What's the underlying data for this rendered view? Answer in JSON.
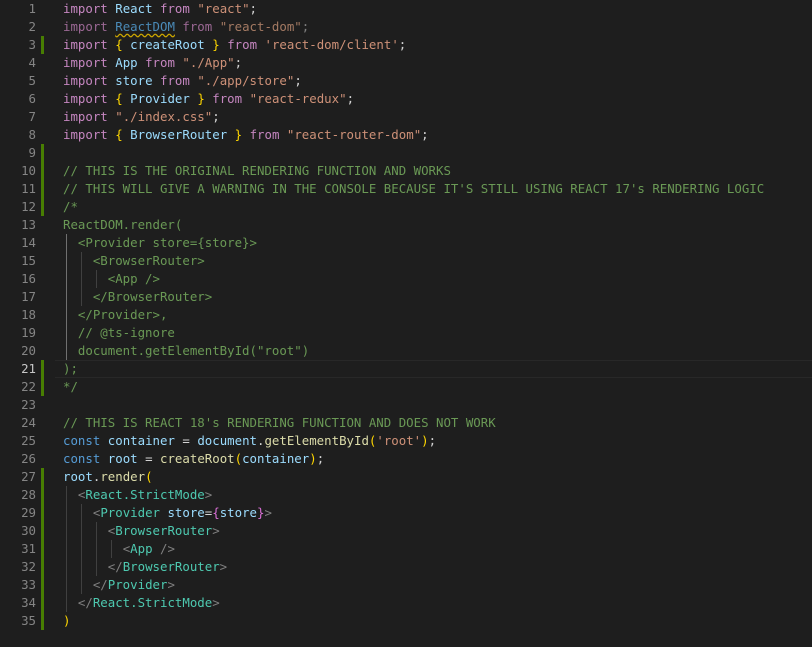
{
  "editor": {
    "language": "javascript",
    "active_line": "21",
    "lines": [
      {
        "n": "1",
        "tokens": [
          [
            "kw",
            "import"
          ],
          [
            "pl",
            " "
          ],
          [
            "id",
            "React"
          ],
          [
            "pl",
            " "
          ],
          [
            "kw",
            "from"
          ],
          [
            "pl",
            " "
          ],
          [
            "str",
            "\"react\""
          ],
          [
            "pl",
            ";"
          ]
        ]
      },
      {
        "n": "2",
        "tokens": [
          [
            "kwd",
            "import"
          ],
          [
            "pl",
            " "
          ],
          [
            "idd squiggle",
            "ReactDOM"
          ],
          [
            "pl",
            " "
          ],
          [
            "kwd",
            "from"
          ],
          [
            "pl",
            " "
          ],
          [
            "strd",
            "\"react-dom\""
          ],
          [
            "tgd",
            ";"
          ]
        ]
      },
      {
        "n": "3",
        "tokens": [
          [
            "kw",
            "import"
          ],
          [
            "pl",
            " "
          ],
          [
            "br1",
            "{"
          ],
          [
            "pl",
            " "
          ],
          [
            "id",
            "createRoot"
          ],
          [
            "pl",
            " "
          ],
          [
            "br1",
            "}"
          ],
          [
            "pl",
            " "
          ],
          [
            "kw",
            "from"
          ],
          [
            "pl",
            " "
          ],
          [
            "str",
            "'react-dom/client'"
          ],
          [
            "pl",
            ";"
          ]
        ]
      },
      {
        "n": "4",
        "tokens": [
          [
            "kw",
            "import"
          ],
          [
            "pl",
            " "
          ],
          [
            "id",
            "App"
          ],
          [
            "pl",
            " "
          ],
          [
            "kw",
            "from"
          ],
          [
            "pl",
            " "
          ],
          [
            "str",
            "\"./App\""
          ],
          [
            "pl",
            ";"
          ]
        ]
      },
      {
        "n": "5",
        "tokens": [
          [
            "kw",
            "import"
          ],
          [
            "pl",
            " "
          ],
          [
            "id",
            "store"
          ],
          [
            "pl",
            " "
          ],
          [
            "kw",
            "from"
          ],
          [
            "pl",
            " "
          ],
          [
            "str",
            "\"./app/store\""
          ],
          [
            "pl",
            ";"
          ]
        ]
      },
      {
        "n": "6",
        "tokens": [
          [
            "kw",
            "import"
          ],
          [
            "pl",
            " "
          ],
          [
            "br1",
            "{"
          ],
          [
            "pl",
            " "
          ],
          [
            "id",
            "Provider"
          ],
          [
            "pl",
            " "
          ],
          [
            "br1",
            "}"
          ],
          [
            "pl",
            " "
          ],
          [
            "kw",
            "from"
          ],
          [
            "pl",
            " "
          ],
          [
            "str",
            "\"react-redux\""
          ],
          [
            "pl",
            ";"
          ]
        ]
      },
      {
        "n": "7",
        "tokens": [
          [
            "kw",
            "import"
          ],
          [
            "pl",
            " "
          ],
          [
            "str",
            "\"./index.css\""
          ],
          [
            "pl",
            ";"
          ]
        ]
      },
      {
        "n": "8",
        "tokens": [
          [
            "kw",
            "import"
          ],
          [
            "pl",
            " "
          ],
          [
            "br1",
            "{"
          ],
          [
            "pl",
            " "
          ],
          [
            "id",
            "BrowserRouter"
          ],
          [
            "pl",
            " "
          ],
          [
            "br1",
            "}"
          ],
          [
            "pl",
            " "
          ],
          [
            "kw",
            "from"
          ],
          [
            "pl",
            " "
          ],
          [
            "str",
            "\"react-router-dom\""
          ],
          [
            "pl",
            ";"
          ]
        ]
      },
      {
        "n": "9",
        "tokens": []
      },
      {
        "n": "10",
        "tokens": [
          [
            "cm",
            "// THIS IS THE ORIGINAL RENDERING FUNCTION AND WORKS"
          ]
        ]
      },
      {
        "n": "11",
        "tokens": [
          [
            "cm",
            "// THIS WILL GIVE A WARNING IN THE CONSOLE BECAUSE IT'S STILL USING REACT 17's RENDERING LOGIC"
          ]
        ]
      },
      {
        "n": "12",
        "tokens": [
          [
            "cm",
            "/*"
          ]
        ]
      },
      {
        "n": "13",
        "tokens": [
          [
            "cm",
            "ReactDOM.render("
          ]
        ]
      },
      {
        "n": "14",
        "tokens": [
          [
            "cm",
            "  <Provider store={store}>"
          ]
        ]
      },
      {
        "n": "15",
        "tokens": [
          [
            "cm",
            "    <BrowserRouter>"
          ]
        ]
      },
      {
        "n": "16",
        "tokens": [
          [
            "cm",
            "      <App />"
          ]
        ]
      },
      {
        "n": "17",
        "tokens": [
          [
            "cm",
            "    </BrowserRouter>"
          ]
        ]
      },
      {
        "n": "18",
        "tokens": [
          [
            "cm",
            "  </Provider>,"
          ]
        ]
      },
      {
        "n": "19",
        "tokens": [
          [
            "cm",
            "  // @ts-ignore"
          ]
        ]
      },
      {
        "n": "20",
        "tokens": [
          [
            "cm",
            "  document.getElementById(\"root\")"
          ]
        ]
      },
      {
        "n": "21",
        "tokens": [
          [
            "cm",
            ");"
          ]
        ]
      },
      {
        "n": "22",
        "tokens": [
          [
            "cm",
            "*/"
          ]
        ]
      },
      {
        "n": "23",
        "tokens": []
      },
      {
        "n": "24",
        "tokens": [
          [
            "cm",
            "// THIS IS REACT 18's RENDERING FUNCTION AND DOES NOT WORK"
          ]
        ]
      },
      {
        "n": "25",
        "tokens": [
          [
            "st",
            "const"
          ],
          [
            "pl",
            " "
          ],
          [
            "id",
            "container"
          ],
          [
            "pl",
            " = "
          ],
          [
            "id",
            "document"
          ],
          [
            "pl",
            "."
          ],
          [
            "fn",
            "getElementById"
          ],
          [
            "br1",
            "("
          ],
          [
            "str",
            "'root'"
          ],
          [
            "br1",
            ")"
          ],
          [
            "pl",
            ";"
          ]
        ]
      },
      {
        "n": "26",
        "tokens": [
          [
            "st",
            "const"
          ],
          [
            "pl",
            " "
          ],
          [
            "id",
            "root"
          ],
          [
            "pl",
            " = "
          ],
          [
            "fn",
            "createRoot"
          ],
          [
            "br1",
            "("
          ],
          [
            "id",
            "container"
          ],
          [
            "br1",
            ")"
          ],
          [
            "pl",
            ";"
          ]
        ]
      },
      {
        "n": "27",
        "tokens": [
          [
            "id",
            "root"
          ],
          [
            "pl",
            "."
          ],
          [
            "fn",
            "render"
          ],
          [
            "br1",
            "("
          ]
        ]
      },
      {
        "n": "28",
        "tokens": [
          [
            "pl",
            "  "
          ],
          [
            "tgd",
            "<"
          ],
          [
            "ty",
            "React.StrictMode"
          ],
          [
            "tgd",
            ">"
          ]
        ]
      },
      {
        "n": "29",
        "tokens": [
          [
            "pl",
            "    "
          ],
          [
            "tgd",
            "<"
          ],
          [
            "ty",
            "Provider"
          ],
          [
            "pl",
            " "
          ],
          [
            "id",
            "store"
          ],
          [
            "pl",
            "="
          ],
          [
            "br2",
            "{"
          ],
          [
            "id",
            "store"
          ],
          [
            "br2",
            "}"
          ],
          [
            "tgd",
            ">"
          ]
        ]
      },
      {
        "n": "30",
        "tokens": [
          [
            "pl",
            "      "
          ],
          [
            "tgd",
            "<"
          ],
          [
            "ty",
            "BrowserRouter"
          ],
          [
            "tgd",
            ">"
          ]
        ]
      },
      {
        "n": "31",
        "tokens": [
          [
            "pl",
            "        "
          ],
          [
            "tgd",
            "<"
          ],
          [
            "ty",
            "App"
          ],
          [
            "pl",
            " "
          ],
          [
            "tgd",
            "/>"
          ]
        ]
      },
      {
        "n": "32",
        "tokens": [
          [
            "pl",
            "      "
          ],
          [
            "tgd",
            "</"
          ],
          [
            "ty",
            "BrowserRouter"
          ],
          [
            "tgd",
            ">"
          ]
        ]
      },
      {
        "n": "33",
        "tokens": [
          [
            "pl",
            "    "
          ],
          [
            "tgd",
            "</"
          ],
          [
            "ty",
            "Provider"
          ],
          [
            "tgd",
            ">"
          ]
        ]
      },
      {
        "n": "34",
        "tokens": [
          [
            "pl",
            "  "
          ],
          [
            "tgd",
            "</"
          ],
          [
            "ty",
            "React.StrictMode"
          ],
          [
            "tgd",
            ">"
          ]
        ]
      },
      {
        "n": "35",
        "tokens": [
          [
            "br1",
            ")"
          ]
        ]
      }
    ],
    "modified_lines": [
      "3",
      "9",
      "10",
      "11",
      "12",
      "21",
      "22",
      "27",
      "28",
      "29",
      "30",
      "31",
      "32",
      "33",
      "34",
      "35"
    ],
    "colors": {
      "background": "#1e1e1e",
      "gutter_modified": "#487e02",
      "keyword": "#c586c0",
      "comment": "#6a9955",
      "string": "#ce9178",
      "identifier": "#9cdcfe",
      "function": "#dcdcaa",
      "component": "#4ec9b0"
    }
  }
}
